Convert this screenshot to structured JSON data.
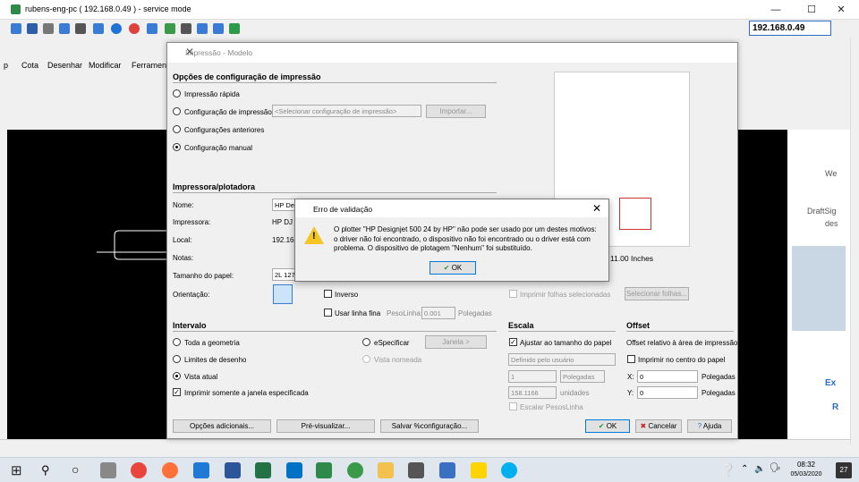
{
  "remote": {
    "title": "rubens-eng-pc ( 192.168.0.49 ) - service mode",
    "ip": "192.168.0.49"
  },
  "cad": {
    "menu": [
      "p",
      "Cota",
      "Desenhar",
      "Modificar",
      "Ferrament"
    ],
    "right_text": [
      "We",
      "DraftSig",
      "des",
      "Ex",
      "R"
    ]
  },
  "dialog": {
    "title": "Impressão - Modelo",
    "config_heading": "Opções de configuração de impressão",
    "opt_quick": "Impressão rápida",
    "opt_config": "Configuração de impressão:",
    "config_select": "<Selecionar configuração de impressão>",
    "import_btn": "Importar...",
    "opt_prev": "Configurações anteriores",
    "opt_manual": "Configuração manual",
    "printer_heading": "Impressora/plotadora",
    "name_label": "Nome:",
    "name_value": "HP Desi",
    "printer_label": "Impressora:",
    "printer_value": "HP DJ 5",
    "local_label": "Local:",
    "local_value": "192.168",
    "notes_label": "Notas:",
    "paper_label": "Tamanho do papel:",
    "paper_value": "2L 127x",
    "orient_label": "Orientação:",
    "inverse": "Inverso",
    "thin_line": "Usar linha fina",
    "weight_label": "PesoLinha:",
    "weight_value": "0.001",
    "weight_unit": "Polegadas",
    "preview_size": "11.00 Inches",
    "print_selected": "Imprimir folhas selecionadas",
    "select_sheets": "Selecionar folhas...",
    "interval_heading": "Intervalo",
    "all_geom": "Toda a geometria",
    "specify": "eSpecificar",
    "window_btn": "Janela >",
    "draw_limits": "Limites de desenho",
    "named_view": "Vista nomeada",
    "current_view": "Vista atual",
    "only_window": "Imprimir somente a janela especificada",
    "scale_heading": "Escala",
    "fit_paper": "Ajustar ao tamanho do papel",
    "scale_select": "Definido pelo usuário",
    "scale_a": "1",
    "scale_unit": "Polegadas",
    "scale_b": "158.1166",
    "scale_units": "unidades",
    "scale_weight": "Escalar PesosLinha",
    "offset_heading": "Offset",
    "offset_rel": "Offset relativo à área de impressão",
    "center": "Imprimir no centro do papel",
    "x_label": "X:",
    "x_value": "0",
    "x_unit": "Polegadas",
    "y_label": "Y:",
    "y_value": "0",
    "y_unit": "Polegadas",
    "more_options": "Opções adicionais...",
    "preview_btn": "Pré-visualizar...",
    "save_btn": "Salvar %configuração...",
    "ok": "OK",
    "cancel": "Cancelar",
    "help": "Ajuda"
  },
  "error": {
    "title": "Erro de validação",
    "message": "O plotter \"HP Designjet 500 24 by HP\" não pode ser usado por um destes motivos: o driver não foi encontrado, o dispositivo não foi encontrado ou o driver está com problema. O dispositivo de plotagem \"Nenhum\" foi substituído.",
    "ok": "OK"
  },
  "taskbar": {
    "time": "08:32",
    "date": "05/03/2020",
    "notif": "27"
  }
}
